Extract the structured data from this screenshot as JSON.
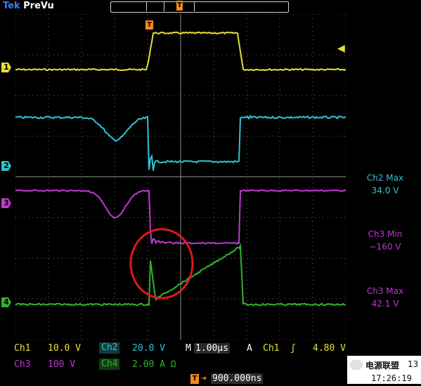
{
  "status": {
    "brand": "Tek",
    "mode": "PreVu"
  },
  "markers": {
    "trigger": "T",
    "ch1": "1",
    "ch2": "2",
    "ch3": "3",
    "ch4": "4"
  },
  "colors": {
    "ch1": "#e6e02e",
    "ch2": "#2bc5d2",
    "ch3": "#c435d6",
    "ch4": "#32b32f",
    "grid": "#6b6b6b",
    "annotation": "#e01818"
  },
  "measurements": [
    {
      "label": "Ch2 Max",
      "value": "34.0 V",
      "channel": "ch2"
    },
    {
      "label": "Ch3 Min",
      "value": "−160 V",
      "channel": "ch3"
    },
    {
      "label": "Ch3 Max",
      "value": "42.1 V",
      "channel": "ch3"
    }
  ],
  "scales": {
    "ch1": {
      "name": "Ch1",
      "value": "10.0 V"
    },
    "ch2": {
      "name": "Ch2",
      "value": "20.0 V"
    },
    "ch3": {
      "name": "Ch3",
      "value": "100 V"
    },
    "ch4": {
      "name": "Ch4",
      "value": "2.00 A Ω"
    }
  },
  "horizontal": {
    "label": "M",
    "value": "1.00µs"
  },
  "trigger": {
    "mode": "A",
    "source": "Ch1",
    "slope": "ʃ",
    "level": "4.80 V"
  },
  "position": {
    "marker": "T",
    "value": "900.000ns"
  },
  "time": "17:26:19",
  "date_fragment": "13",
  "watermark": "电源联盟"
}
